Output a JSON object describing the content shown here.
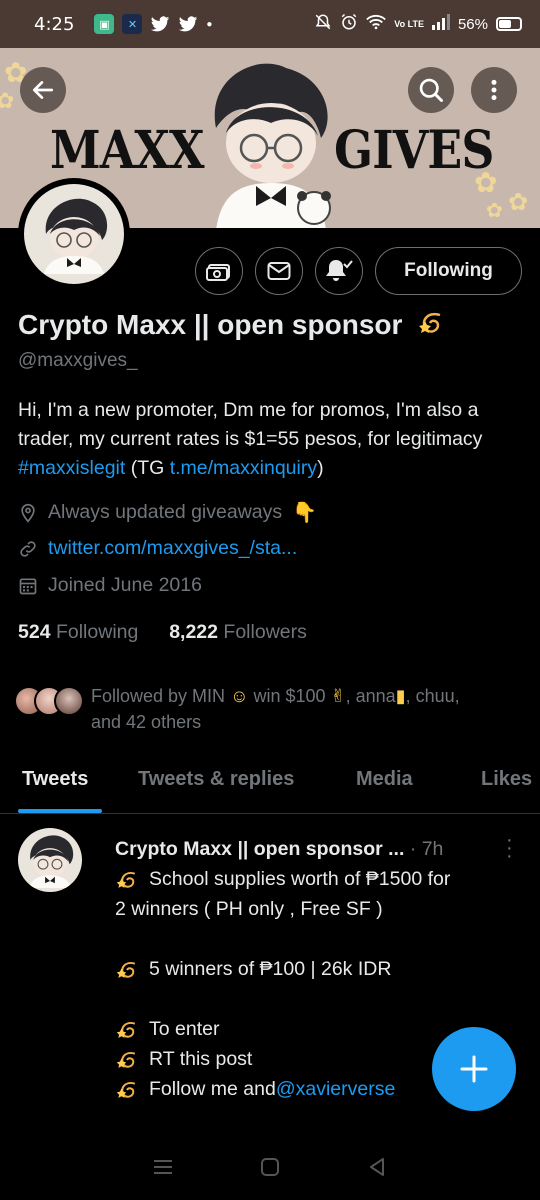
{
  "status_bar": {
    "time": "4:25",
    "right_text": "Vo LTE",
    "battery": "56%",
    "battery_level": 0.56
  },
  "banner": {
    "left_text": "MAXX",
    "right_text": "GIVES"
  },
  "header": {
    "back_icon": "arrow-left-icon",
    "search_icon": "search-icon",
    "more_icon": "more-vertical-icon"
  },
  "profile": {
    "name": "Crypto Maxx || open sponsor",
    "handle": "@maxxgives_",
    "follow_label": "Following",
    "bio_1": "Hi, I'm a new promoter, Dm me for promos, I'm also a trader, my current rates is $1=55 pesos, for legitimacy ",
    "bio_hashtag": "#maxxislegit",
    "bio_2": " (TG ",
    "bio_link": "t.me/maxxinquiry",
    "bio_3": ")",
    "location": "Always updated giveaways",
    "website": "twitter.com/maxxgives_/sta...",
    "joined": "Joined June 2016",
    "following_count": "524",
    "following_label": "Following",
    "followers_count": "8,222",
    "followers_label": "Followers",
    "followed_by_1": "Followed by MIN",
    "followed_by_2": "win $100",
    "followed_by_3": ", anna",
    "followed_by_4": ", chuu,",
    "followed_by_5": "and 42 others"
  },
  "tabs": [
    "Tweets",
    "Tweets & replies",
    "Media",
    "Likes"
  ],
  "tweet": {
    "name": "Crypto Maxx || open sponsor ...",
    "time": "· 7h",
    "line_1": "School supplies worth of ₱1500 for",
    "line_2": "2 winners ( PH only , Free SF )",
    "line_3": "5 winners of ₱100 | 26k IDR",
    "line_4": "To enter",
    "line_5": "RT this post",
    "line_6": "Follow me and ",
    "line_6_mention": "@xavierverse"
  },
  "colors": {
    "accent": "#1d9bf0",
    "muted": "#71767b",
    "banner_bg": "#c8b7ac",
    "status_bar_bg": "#4a3a33"
  }
}
